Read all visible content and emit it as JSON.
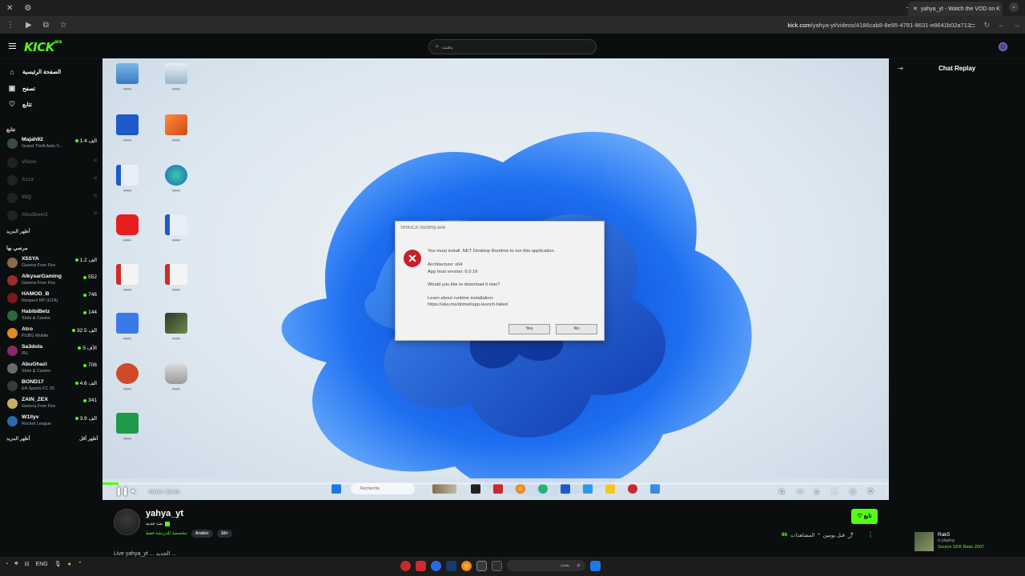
{
  "browser": {
    "tab_title": "yahya_yt - Watch the VOD on K",
    "url_domain": "kick.com",
    "url_path": "/yahya-yt/videos/4186cab8-8e95-4781-8631-e8641b02a713"
  },
  "header": {
    "logo": "KICK",
    "logo_sup": "BETA",
    "search_placeholder": "بحث"
  },
  "sidebar": {
    "nav": [
      {
        "label": "الصفحة الرئيسية",
        "icon": "home-icon"
      },
      {
        "label": "تصفح",
        "icon": "browse-icon"
      },
      {
        "label": "تتابع",
        "icon": "heart-icon"
      }
    ],
    "following_title": "تتابع",
    "following": [
      {
        "name": "Majah92",
        "game": "Grand Theft Auto V...",
        "viewers": "1.4 الف",
        "live": true
      },
      {
        "name": "Viiion",
        "game": "",
        "viewers": "",
        "live": false
      },
      {
        "name": "Azzz",
        "game": "",
        "viewers": "",
        "live": false
      },
      {
        "name": "INQ",
        "game": "",
        "viewers": "",
        "live": false
      },
      {
        "name": "AbuBwel1",
        "game": "",
        "viewers": "",
        "live": false
      }
    ],
    "show_more": "أظهر المزيد",
    "recommended_title": "مرصي بها",
    "recommended": [
      {
        "name": "X5SYA",
        "game": "Garena Free Fire",
        "viewers": "1.2 الف"
      },
      {
        "name": "AlkysarGaming",
        "game": "Garena Free Fire",
        "viewers": "552"
      },
      {
        "name": "HAMOD_B",
        "game": "Respect RP (GTA)",
        "viewers": "746"
      },
      {
        "name": "HabibiBetz",
        "game": "Slots & Casino",
        "viewers": "144"
      },
      {
        "name": "Atro",
        "game": "PUBG Mobile",
        "viewers": "32.5 الف"
      },
      {
        "name": "Sa3dola",
        "game": "IRL",
        "viewers": "5 الآف"
      },
      {
        "name": "AbuGhazi",
        "game": "Slots & Casino",
        "viewers": "706"
      },
      {
        "name": "BOND17",
        "game": "EA Sports FC 25",
        "viewers": "4.6 الف"
      },
      {
        "name": "ZAIN_ZEX",
        "game": "Garena Free Fire",
        "viewers": "341"
      },
      {
        "name": "W1llyv",
        "game": "Rocket League",
        "viewers": "3.9 الف"
      }
    ],
    "show_more2": "أظهر المزيد",
    "show_less": "أظهر أقل"
  },
  "video": {
    "time": "00:00 / 26:50",
    "progress": 0.02,
    "dialog": {
      "title": "SHIUCA Sootmp.exe",
      "line1": "You must install .NET Desktop Runtime to run this application.",
      "line2": "Architecture: x64",
      "line3": "App host version: 6.0.16",
      "line4": "Would you like to download it now?",
      "line5": "Learn about runtime installation:",
      "line6": "https://aka.ms/dotnet/app-launch-failed",
      "yes": "Yes",
      "no": "No"
    },
    "taskbar_search": "Recherche"
  },
  "chat": {
    "title": "Chat Replay",
    "rec_name": "Rak5",
    "rec_status": "is playing",
    "rec_game": "Source SDK Base 2007"
  },
  "channel": {
    "name": "yahya_yt",
    "subtitle": "بث جديد",
    "category": "مخصصة للدردشة فقط",
    "tag1": "Arabic",
    "tag2": "18+",
    "follow": "تابع",
    "views_count": "86",
    "views_label": "المشاهدات",
    "age": "قبل يومين",
    "title": "Live yahya_yt ... الجديد ..."
  },
  "os": {
    "lang": "ENG",
    "search": "بحث"
  },
  "colors": {
    "accent": "#53fc18",
    "bg": "#0b0e0f"
  }
}
